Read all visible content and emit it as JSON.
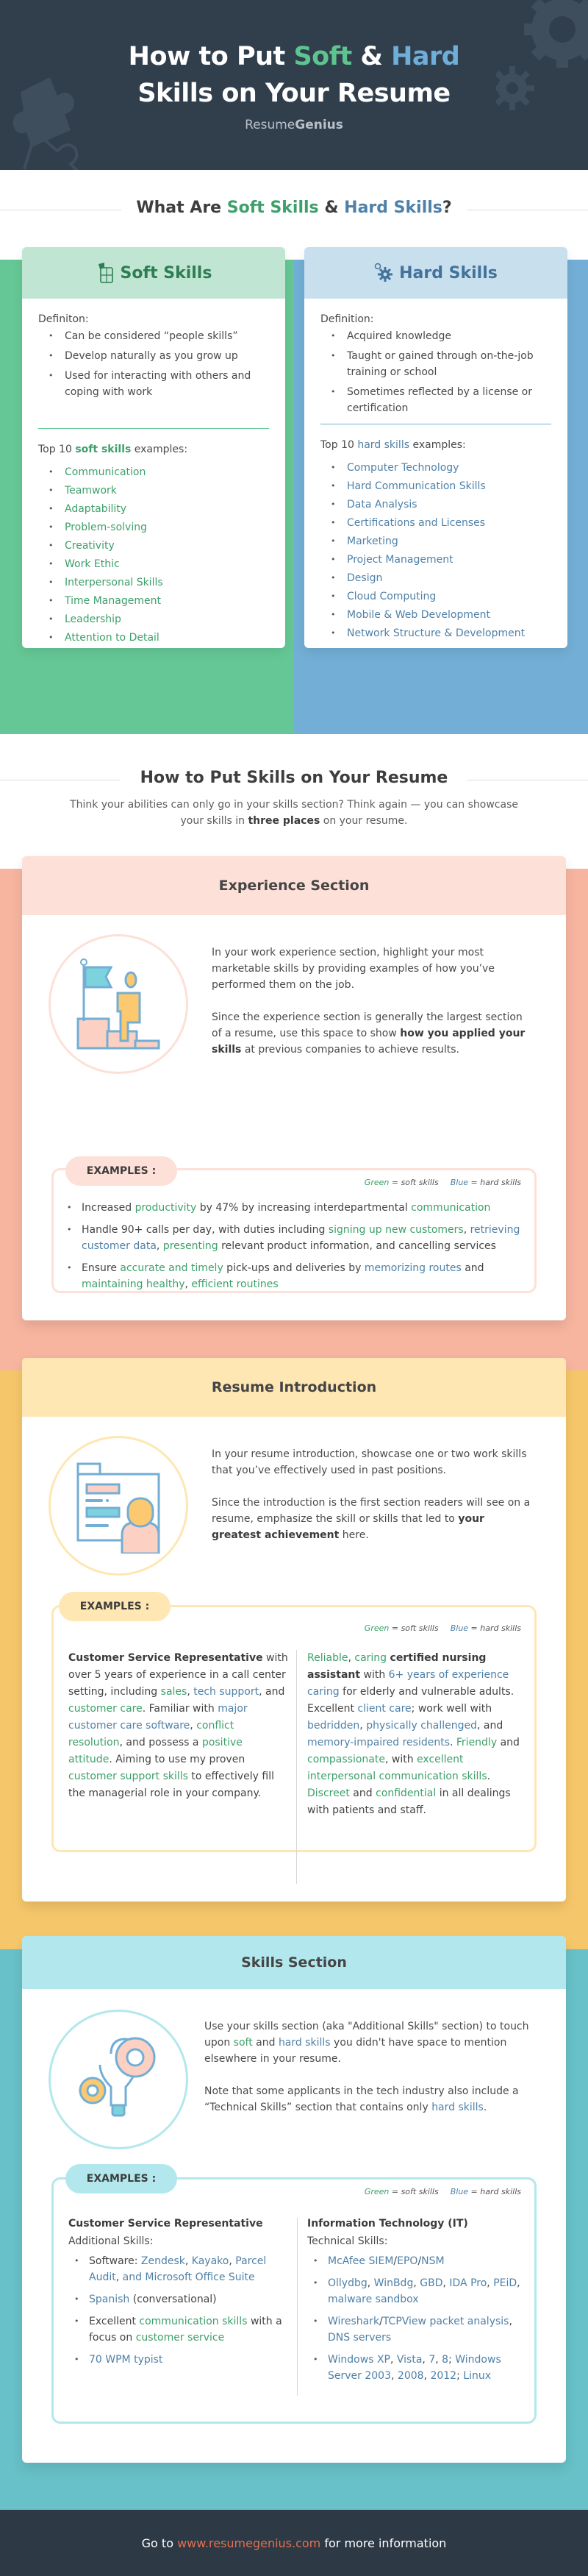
{
  "header": {
    "title_part1": "How to Put ",
    "title_soft": "Soft",
    "title_amp": " & ",
    "title_hard": "Hard",
    "title_line2": "Skills on Your Resume",
    "brand_light": "Resume",
    "brand_bold": "Genius"
  },
  "what_are": {
    "heading_prefix": "What Are ",
    "heading_soft": "Soft Skills",
    "heading_amp": " & ",
    "heading_hard": "Hard Skills",
    "heading_suffix": "?"
  },
  "soft_card": {
    "title": "Soft Skills",
    "icon": "puzzle-icon",
    "definition_label": "Definiton:",
    "definitions": [
      "Can be considered “people skills”",
      "Develop naturally as you grow up",
      "Used for interacting with others and coping with work"
    ],
    "examples_prefix": "Top 10 ",
    "examples_key": "soft skills",
    "examples_suffix": " examples:",
    "examples": [
      "Communication",
      "Teamwork",
      "Adaptability",
      "Problem-solving",
      "Creativity",
      "Work Ethic",
      "Interpersonal Skills",
      "Time Management",
      "Leadership",
      "Attention to Detail"
    ]
  },
  "hard_card": {
    "title": "Hard Skills",
    "icon": "gears-icon",
    "definition_label": "Definition:",
    "definitions": [
      "Acquired knowledge",
      "Taught or gained through on-the-job training or school",
      "Sometimes reflected by a license or certification"
    ],
    "examples_prefix": "Top 10 ",
    "examples_key": "hard skills",
    "examples_suffix": " examples:",
    "examples": [
      "Computer Technology",
      "Hard Communication Skills",
      "Data Analysis",
      "Certifications and Licenses",
      "Marketing",
      "Project Management",
      "Design",
      "Cloud Computing",
      "Mobile & Web Development",
      "Network Structure & Development"
    ]
  },
  "how_to": {
    "heading": "How to Put Skills on Your Resume",
    "intro_a": "Think your abilities can only go in your skills section? Think again — you can showcase your skills in ",
    "intro_bold": "three places",
    "intro_b": " on your resume."
  },
  "legend": {
    "green": "Green",
    "green_rest": " = soft skills",
    "blue": "Blue",
    "blue_rest": " = hard skills"
  },
  "examples_tab": "EXAMPLES :",
  "experience": {
    "title": "Experience Section",
    "icon": "flag-climber-icon",
    "p1": "In your work experience section, highlight your most marketable skills by providing examples of how you’ve performed them on the job.",
    "p2_a": "Since the experience section is generally the largest section of a resume, use this space to show ",
    "p2_bold": "how you applied your skills",
    "p2_b": " at previous companies to achieve results.",
    "bullets": [
      [
        [
          "t",
          "Increased "
        ],
        [
          "g",
          "productivity"
        ],
        [
          "t",
          " by 47% by increasing interdepartmental "
        ],
        [
          "g",
          "communication"
        ]
      ],
      [
        [
          "t",
          "Handle 90+ calls per day, with duties including "
        ],
        [
          "g",
          "signing up new customers"
        ],
        [
          "t",
          ", "
        ],
        [
          "b",
          "retrieving customer data"
        ],
        [
          "t",
          ", "
        ],
        [
          "g",
          "presenting"
        ],
        [
          "t",
          " relevant product information, and cancelling services"
        ]
      ],
      [
        [
          "t",
          "Ensure "
        ],
        [
          "g",
          "accurate and timely"
        ],
        [
          "t",
          " pick-ups and deliveries by "
        ],
        [
          "b",
          "memorizing routes"
        ],
        [
          "t",
          " and "
        ],
        [
          "g",
          "maintaining healthy"
        ],
        [
          "t",
          ", "
        ],
        [
          "g",
          "efficient routines"
        ]
      ]
    ]
  },
  "introduction": {
    "title": "Resume Introduction",
    "icon": "presenter-board-icon",
    "p1": "In your resume introduction, showcase one or two work skills that you’ve effectively used in past positions.",
    "p2_a": "Since the introduction is the first section readers will see on a resume, emphasize the skill or skills that led to ",
    "p2_bold": "your greatest achievement",
    "p2_b": " here.",
    "left": [
      [
        "s",
        "Customer Service Representative"
      ],
      [
        "t",
        " with over 5 years of experience in a call center setting, including "
      ],
      [
        "g",
        "sales"
      ],
      [
        "t",
        ", "
      ],
      [
        "b",
        "tech support"
      ],
      [
        "t",
        ", and "
      ],
      [
        "g",
        "customer care"
      ],
      [
        "t",
        ". Familiar with "
      ],
      [
        "b",
        "major customer care software"
      ],
      [
        "t",
        ", "
      ],
      [
        "g",
        "conflict resolution"
      ],
      [
        "t",
        ", and possess a "
      ],
      [
        "g",
        "positive attitude"
      ],
      [
        "t",
        ". Aiming to use my proven "
      ],
      [
        "g",
        "customer support skills"
      ],
      [
        "t",
        " to effectively fill the managerial role in your company."
      ]
    ],
    "right": [
      [
        "g",
        "Reliable"
      ],
      [
        "t",
        ", "
      ],
      [
        "g",
        "caring"
      ],
      [
        "t",
        " "
      ],
      [
        "s",
        "certified nursing assistant"
      ],
      [
        "t",
        " with "
      ],
      [
        "b",
        "6+ years of experience caring"
      ],
      [
        "t",
        " for elderly and vulnerable adults. Excellent "
      ],
      [
        "b",
        "client care"
      ],
      [
        "t",
        "; work well with "
      ],
      [
        "b",
        "bedridden"
      ],
      [
        "t",
        ", "
      ],
      [
        "b",
        "physically challenged"
      ],
      [
        "t",
        ", and "
      ],
      [
        "b",
        "memory-impaired residents"
      ],
      [
        "t",
        ". "
      ],
      [
        "g",
        "Friendly"
      ],
      [
        "t",
        " and "
      ],
      [
        "g",
        "compassionate"
      ],
      [
        "t",
        ", with "
      ],
      [
        "g",
        "excellent interpersonal communication skills"
      ],
      [
        "t",
        ". "
      ],
      [
        "g",
        "Discreet"
      ],
      [
        "t",
        " and "
      ],
      [
        "g",
        "confidential"
      ],
      [
        "t",
        " in all dealings with patients and staff."
      ]
    ]
  },
  "skills_section": {
    "title": "Skills Section",
    "icon": "lightbulb-gears-icon",
    "p1": [
      [
        "t",
        "Use your skills section (aka \"Additional Skills\" section) to touch upon "
      ],
      [
        "g",
        "soft"
      ],
      [
        "t",
        " and "
      ],
      [
        "b",
        "hard skills"
      ],
      [
        "t",
        " you didn't have space to mention elsewhere in your resume."
      ]
    ],
    "p2": [
      [
        "t",
        "Note that some applicants in the tech industry also include a “Technical Skills” section that contains only "
      ],
      [
        "b",
        "hard skills"
      ],
      [
        "t",
        "."
      ]
    ],
    "left_title": "Customer Service Representative",
    "left_sub": "Additional Skills:",
    "left_items": [
      [
        [
          "t",
          "Software: "
        ],
        [
          "b",
          "Zendesk"
        ],
        [
          "t",
          ", "
        ],
        [
          "b",
          "Kayako"
        ],
        [
          "t",
          ", "
        ],
        [
          "b",
          "Parcel Audit"
        ],
        [
          "t",
          ", "
        ],
        [
          "b",
          "and Microsoft Office Suite"
        ]
      ],
      [
        [
          "b",
          "Spanish"
        ],
        [
          "t",
          " (conversational)"
        ]
      ],
      [
        [
          "t",
          "Excellent "
        ],
        [
          "g",
          "communication skills"
        ],
        [
          "t",
          " with a focus on "
        ],
        [
          "g",
          "customer service"
        ]
      ],
      [
        [
          "b",
          "70 WPM typist"
        ]
      ]
    ],
    "right_title": "Information Technology (IT)",
    "right_sub": "Technical Skills:",
    "right_items": [
      [
        [
          "b",
          "McAfee SIEM"
        ],
        [
          "t",
          "/"
        ],
        [
          "b",
          "EPO"
        ],
        [
          "t",
          "/"
        ],
        [
          "b",
          "NSM"
        ]
      ],
      [
        [
          "b",
          "Ollydbg"
        ],
        [
          "t",
          ", "
        ],
        [
          "b",
          "WinBdg"
        ],
        [
          "t",
          ", "
        ],
        [
          "b",
          "GBD"
        ],
        [
          "t",
          ", "
        ],
        [
          "b",
          "IDA Pro"
        ],
        [
          "t",
          ", "
        ],
        [
          "b",
          "PEiD"
        ],
        [
          "t",
          ", "
        ],
        [
          "b",
          "malware sandbox"
        ]
      ],
      [
        [
          "b",
          "Wireshark"
        ],
        [
          "t",
          "/"
        ],
        [
          "b",
          "TCPView packet analysis"
        ],
        [
          "t",
          ", "
        ],
        [
          "b",
          "DNS servers"
        ]
      ],
      [
        [
          "b",
          "Windows XP"
        ],
        [
          "t",
          ", "
        ],
        [
          "b",
          "Vista"
        ],
        [
          "t",
          ", "
        ],
        [
          "b",
          "7"
        ],
        [
          "t",
          ", "
        ],
        [
          "b",
          "8"
        ],
        [
          "t",
          "; "
        ],
        [
          "b",
          "Windows Server 2003"
        ],
        [
          "t",
          ", "
        ],
        [
          "b",
          "2008"
        ],
        [
          "t",
          ", "
        ],
        [
          "b",
          "2012"
        ],
        [
          "t",
          "; "
        ],
        [
          "b",
          "Linux"
        ]
      ]
    ]
  },
  "footer": {
    "prefix": "Go to ",
    "link": "www.resumegenius.com",
    "suffix": " for more information"
  },
  "colors": {
    "soft_green": "#3da06a",
    "hard_blue": "#4f81a8",
    "header_bg": "#313f4d",
    "experience_accent": "#f7b5a0",
    "intro_accent": "#f7c96b",
    "skills_accent": "#68c1c8",
    "footer_link": "#e1704f"
  }
}
